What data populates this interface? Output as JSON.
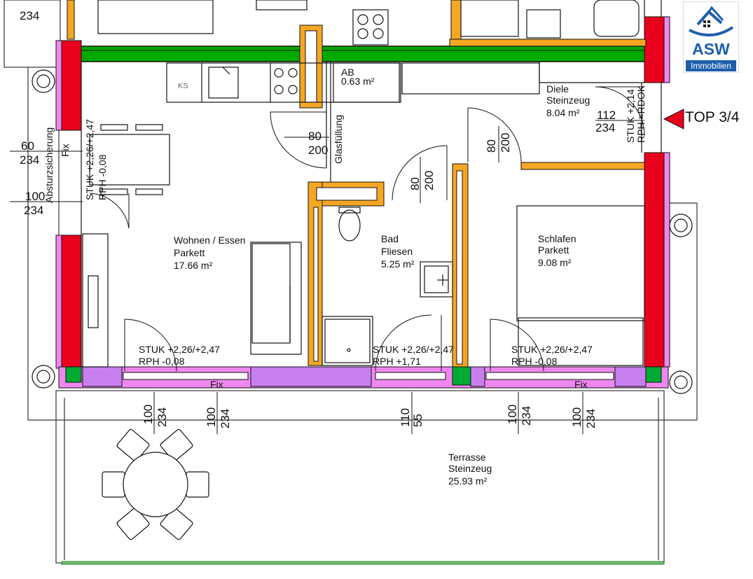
{
  "logo": {
    "name": "ASW",
    "subtitle": "Immobilien"
  },
  "unit_label": "TOP 3/4",
  "rooms": {
    "wohnen": {
      "name": "Wohnen / Essen",
      "floor": "Parkett",
      "area": "17.66 m²"
    },
    "bad": {
      "name": "Bad",
      "floor": "Fliesen",
      "area": "5.25 m²"
    },
    "schlafen": {
      "name": "Schlafen",
      "floor": "Parkett",
      "area": "9.08 m²"
    },
    "diele": {
      "name": "Diele",
      "floor": "Steinzeug",
      "area": "8.04 m²"
    },
    "ab": {
      "name": "AB",
      "area": "0.63 m²"
    },
    "terrasse": {
      "name": "Terrasse",
      "floor": "Steinzeug",
      "area": "25.93 m²"
    }
  },
  "kitchen": {
    "fridge": "KS"
  },
  "labels": {
    "absturz": "Absturzsicherung",
    "fix": "Fix",
    "glas": "Glasfüllung",
    "stuk_left": "STUK +2,26/+2,47",
    "rph_left": "RPH   -0,08",
    "stuk_diele": "STUK +2,14",
    "rph_diele": "RPH =RDOK"
  },
  "windows": [
    {
      "stuk": "STUK +2,26/+2,47",
      "rph": "RPH   -0,08"
    },
    {
      "stuk": "STUK +2,26/+2,47",
      "rph": "RPH  +1,71"
    },
    {
      "stuk": "STUK +2,26/+2,47",
      "rph": "RPH   -0,08"
    }
  ],
  "dims": {
    "top_left": "234",
    "left_60": "60",
    "left_60b": "234",
    "left_100": "100",
    "left_100b": "234",
    "door_80": "80",
    "door_200": "200",
    "d112": "112",
    "d112b": "234",
    "bottom": [
      {
        "a": "100",
        "b": "234"
      },
      {
        "a": "100",
        "b": "234"
      },
      {
        "a": "110",
        "b": "55"
      },
      {
        "a": "100",
        "b": "234"
      },
      {
        "a": "100",
        "b": "234"
      }
    ]
  }
}
